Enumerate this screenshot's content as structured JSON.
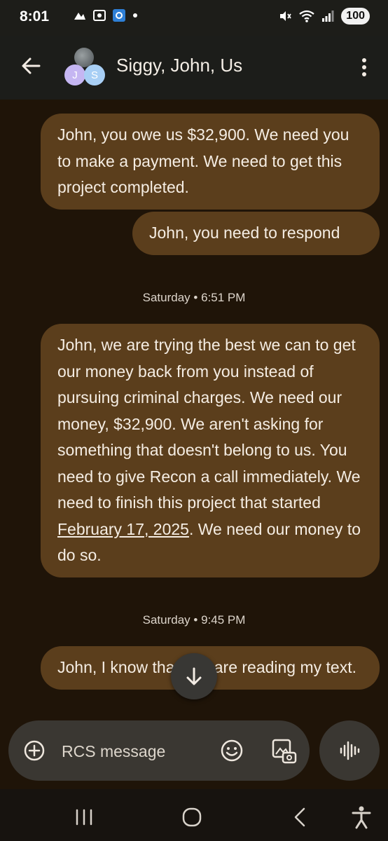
{
  "status_bar": {
    "time": "8:01",
    "battery": "100",
    "left_icons": [
      "notification-icon",
      "screenshot-icon",
      "app-icon",
      "dot-icon"
    ],
    "right_icons": [
      "mute-icon",
      "wifi-icon",
      "signal-icon"
    ]
  },
  "header": {
    "title": "Siggy, John, Us",
    "avatars": [
      {
        "initial": "J",
        "color": "#c5b6f2"
      },
      {
        "initial": "S",
        "color": "#a8cff5"
      }
    ]
  },
  "messages": {
    "m1": "John, you owe us $32,900.  We need you to make a payment.  We need to get this project completed.",
    "m2": "John, you need to respond",
    "t1": "Saturday • 6:51 PM",
    "m3_part1": "John, we are trying the best we can to get our money back from you instead of pursuing criminal charges.  We need our money, $32,900. We aren't asking for something that doesn't belong to us. You need to give Recon a call immediately.  We need to finish this project that started ",
    "m3_link": "February 17, 2025",
    "m3_part2": ". We need our money to do so.",
    "t2": "Saturday • 9:45 PM",
    "m4": "John, I know that you are reading my text."
  },
  "composer": {
    "placeholder": "RCS message"
  },
  "colors": {
    "bubble": "#5b3e1c",
    "background": "#1f1408",
    "app_bar": "#1c1d1a"
  }
}
